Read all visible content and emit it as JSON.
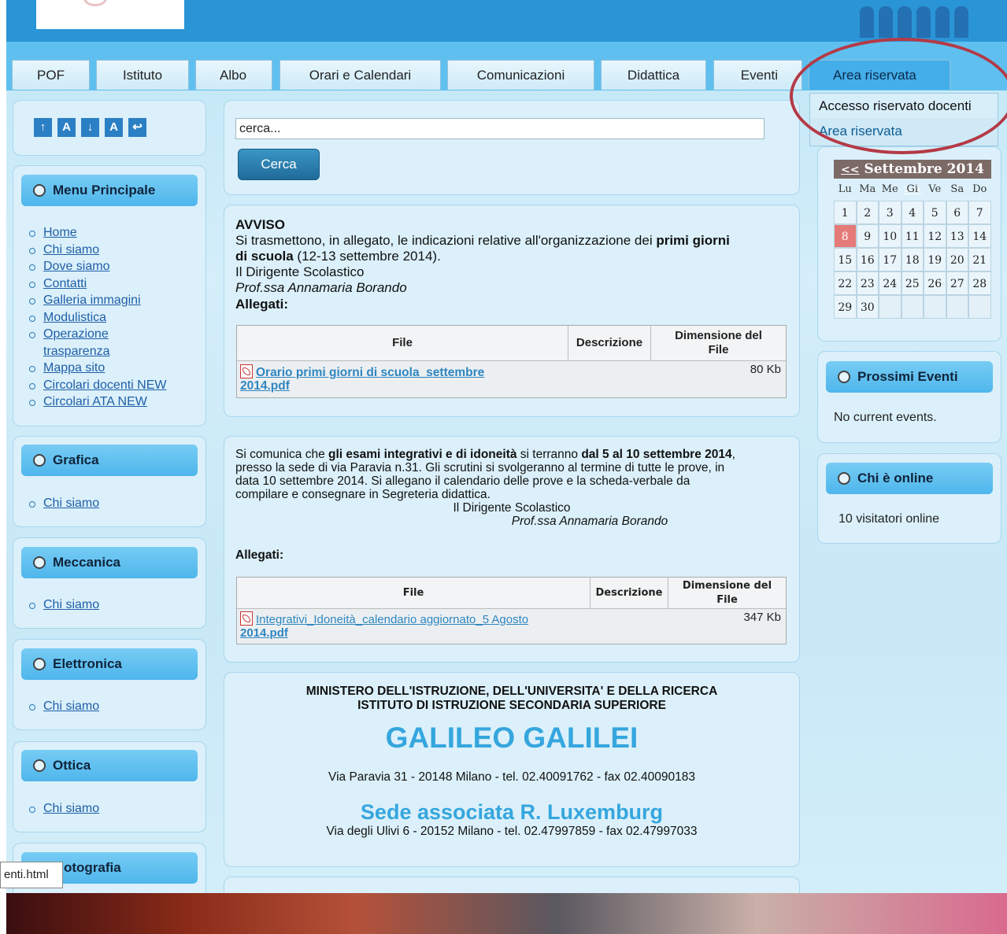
{
  "nav": {
    "tabs": [
      "POF",
      "Istituto",
      "Albo",
      "Orari e Calendari",
      "Comunicazioni",
      "Didattica",
      "Eventi",
      "Area riservata"
    ]
  },
  "dropdown": {
    "items": [
      "Accesso riservato docenti",
      "Area riservata"
    ]
  },
  "accessibility": {
    "buttons": [
      "↑",
      "A",
      "↓",
      "A",
      "↩"
    ]
  },
  "search": {
    "value": "cerca...",
    "button": "Cerca"
  },
  "menu_principale": {
    "title": "Menu Principale",
    "items": [
      "Home",
      "Chi siamo",
      "Dove siamo",
      "Contatti",
      "Galleria immagini",
      "Modulistica",
      "Operazione",
      "trasparenza",
      "Mappa sito",
      "Circolari docenti NEW",
      "Circolari ATA NEW"
    ]
  },
  "side_sections": [
    {
      "title": "Grafica",
      "link": "Chi siamo"
    },
    {
      "title": "Meccanica",
      "link": "Chi siamo"
    },
    {
      "title": "Elettronica",
      "link": "Chi siamo"
    },
    {
      "title": "Ottica",
      "link": "Chi siamo"
    },
    {
      "title": "otografia"
    }
  ],
  "avviso": {
    "heading": "AVVISO",
    "line1": "Si trasmettono, in allegato, le indicazioni relative all'organizzazione dei ",
    "bold1": "primi giorni",
    "bold2": "di scuola",
    "line2": " (12-13 settembre 2014).",
    "signer_title": "Il Dirigente Scolastico",
    "signer_name": "Prof.ssa Annamaria Borando",
    "allegati": "Allegati:",
    "table": {
      "headers": [
        "File",
        "Descrizione",
        "Dimensione del File"
      ],
      "file_line1": "Orario primi giorni di scuola_settembre",
      "file_line2": "2014.pdf",
      "size": "80 Kb"
    }
  },
  "esami": {
    "p1a": "Si comunica che ",
    "p1b": "gli esami integrativi e di idoneità",
    "p1c": " si terranno ",
    "p1d": "dal 5 al 10 settembre 2014",
    "p1e": ",",
    "p2": "presso la sede di via Paravia n.31. Gli scrutini si svolgeranno al termine di tutte le prove, in",
    "p3": "data 10 settembre 2014. Si allegano  il calendario delle prove e la scheda-verbale da",
    "p4": "compilare e consegnare in Segreteria didattica.",
    "signer_title": "Il Dirigente Scolastico",
    "signer_name": "Prof.ssa Annamaria Borando",
    "allegati": "Allegati:",
    "table": {
      "headers": [
        "File",
        "Descrizione",
        "Dimensione del File"
      ],
      "file_line1": "Integrativi_Idoneità_calendario aggiornato_5 Agosto",
      "file_line2": "2014.pdf",
      "size": "347 Kb"
    }
  },
  "school": {
    "line1": "MINISTERO DELL'ISTRUZIONE, DELL'UNIVERSITA' E DELLA RICERCA",
    "line2": "ISTITUTO DI ISTRUZIONE SECONDARIA SUPERIORE",
    "name": "GALILEO GALILEI",
    "address": "Via Paravia 31 - 20148 Milano - tel. 02.40091762 - fax 02.40090183",
    "sede": "Sede associata R. Luxemburg",
    "sede_address": "Via degli Ulivi 6 - 20152 Milano - tel. 02.47997859 - fax 02.47997033"
  },
  "calendar": {
    "prev": "<<",
    "month": "Settembre 2014",
    "next": ">>",
    "days": [
      "Lu",
      "Ma",
      "Me",
      "Gi",
      "Ve",
      "Sa",
      "Do"
    ],
    "weeks": [
      [
        "1",
        "2",
        "3",
        "4",
        "5",
        "6",
        "7"
      ],
      [
        "8",
        "9",
        "10",
        "11",
        "12",
        "13",
        "14"
      ],
      [
        "15",
        "16",
        "17",
        "18",
        "19",
        "20",
        "21"
      ],
      [
        "22",
        "23",
        "24",
        "25",
        "26",
        "27",
        "28"
      ],
      [
        "29",
        "30",
        "",
        "",
        "",
        "",
        ""
      ]
    ],
    "today": "8"
  },
  "events": {
    "title": "Prossimi Eventi",
    "text": "No current events."
  },
  "online": {
    "title": "Chi è online",
    "text": "10 visitatori online"
  },
  "status_bar": "enti.html"
}
